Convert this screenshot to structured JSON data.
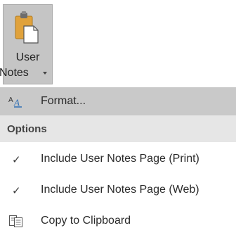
{
  "ribbon": {
    "button_label_line1": "User",
    "button_label_line2": "Notes",
    "icon": "clipboard-paste-icon"
  },
  "menu": {
    "format_label": "Format...",
    "format_icon": "format-text-icon",
    "section_header": "Options",
    "print_label": "Include User Notes Page (Print)",
    "web_label": "Include User Notes Page (Web)",
    "copy_label": "Copy to Clipboard",
    "check_icon": "checkmark-icon",
    "copy_icon": "copy-clipboard-icon"
  },
  "colors": {
    "ribbon_button_bg": "#c5c5c5",
    "highlight_bg": "#c9c9c9",
    "section_bg": "#e6e6e6",
    "clipboard_orange": "#e0a23c",
    "format_blue": "#2f6fb5"
  }
}
